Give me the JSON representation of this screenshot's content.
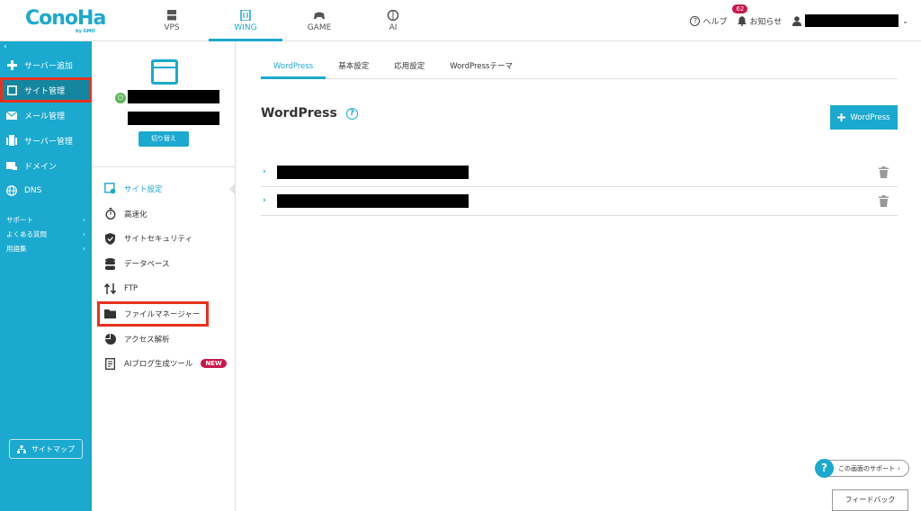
{
  "brand": {
    "logo": "ConoHa",
    "logo_sub": "by GMO",
    "accent": "#1ba9cf"
  },
  "topnav": [
    {
      "label": "VPS",
      "icon": "server-icon"
    },
    {
      "label": "WING",
      "icon": "wing-server-icon",
      "active": true
    },
    {
      "label": "GAME",
      "icon": "gamepad-icon"
    },
    {
      "label": "AI",
      "icon": "brain-icon"
    }
  ],
  "header": {
    "help": "ヘルプ",
    "notifications": "お知らせ",
    "notification_count": "62"
  },
  "sidebar": {
    "items": [
      {
        "label": "サーバー追加",
        "icon": "plus-icon"
      },
      {
        "label": "サイト管理",
        "icon": "site-icon",
        "active": true
      },
      {
        "label": "メール管理",
        "icon": "mail-icon"
      },
      {
        "label": "サーバー管理",
        "icon": "server-manage-icon"
      },
      {
        "label": "ドメイン",
        "icon": "domain-icon"
      },
      {
        "label": "DNS",
        "icon": "globe-icon"
      }
    ],
    "links": [
      {
        "label": "サポート"
      },
      {
        "label": "よくある質問"
      },
      {
        "label": "用語集"
      }
    ],
    "sitemap": "サイトマップ"
  },
  "site_card": {
    "switch_label": "切り替え"
  },
  "submenu": [
    {
      "label": "サイト設定",
      "icon": "site-settings-icon",
      "active": true
    },
    {
      "label": "高速化",
      "icon": "stopwatch-icon"
    },
    {
      "label": "サイトセキュリティ",
      "icon": "shield-icon"
    },
    {
      "label": "データベース",
      "icon": "database-icon"
    },
    {
      "label": "FTP",
      "icon": "transfer-icon"
    },
    {
      "label": "ファイルマネージャー",
      "icon": "folder-icon",
      "highlight": true
    },
    {
      "label": "アクセス解析",
      "icon": "pie-chart-icon"
    },
    {
      "label": "AIブログ生成ツール",
      "icon": "document-icon",
      "badge": "NEW"
    }
  ],
  "tabs": [
    {
      "label": "WordPress",
      "active": true
    },
    {
      "label": "基本設定"
    },
    {
      "label": "応用設定"
    },
    {
      "label": "WordPressテーマ"
    }
  ],
  "main": {
    "title": "WordPress",
    "add_button": "WordPress",
    "rows": [
      {
        "name": ""
      },
      {
        "name": ""
      }
    ]
  },
  "support_button": "この画面のサポート",
  "feedback_button": "フィードバック"
}
